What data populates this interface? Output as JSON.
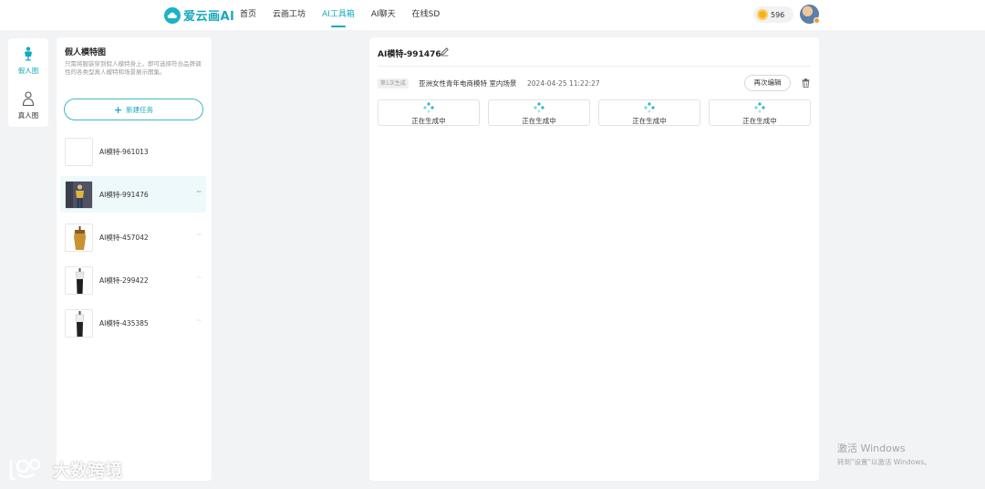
{
  "app": {
    "logo_text": "爱云画AI",
    "brand_color": "#17a9bf"
  },
  "nav": {
    "items": [
      {
        "label": "首页",
        "active": false
      },
      {
        "label": "云画工坊",
        "active": false
      },
      {
        "label": "AI工具箱",
        "active": true
      },
      {
        "label": "AI聊天",
        "active": false
      },
      {
        "label": "在线SD",
        "active": false
      }
    ]
  },
  "user": {
    "coins": "596"
  },
  "rail": {
    "items": [
      {
        "label": "假人图",
        "icon": "mannequin-icon",
        "active": true
      },
      {
        "label": "真人图",
        "icon": "person-icon",
        "active": false
      }
    ]
  },
  "panel": {
    "title": "假人模特图",
    "description": "只需将服装穿到假人模特身上，即可选择符合品牌调性的各类型真人模特和场景展示图集。",
    "new_task_label": "新建任务",
    "tasks": [
      {
        "name": "AI模特-961013",
        "thumb": "empty",
        "selected": false
      },
      {
        "name": "AI模特-991476",
        "thumb": "photo-dark",
        "selected": true
      },
      {
        "name": "AI模特-457042",
        "thumb": "mannequin-gold",
        "selected": false
      },
      {
        "name": "AI模特-299422",
        "thumb": "mannequin-black",
        "selected": false
      },
      {
        "name": "AI模特-435385",
        "thumb": "mannequin-black",
        "selected": false
      }
    ],
    "more_label": "···"
  },
  "main": {
    "title": "AI模特-991476",
    "generation": {
      "tag": "第1次生成",
      "description": "亚洲女性青年电商模特 室内场景",
      "time": "2024-04-25 11:22:27",
      "reedit_label": "再次编辑",
      "cards": [
        {
          "status": "正在生成中"
        },
        {
          "status": "正在生成中"
        },
        {
          "status": "正在生成中"
        },
        {
          "status": "正在生成中"
        }
      ]
    }
  },
  "watermark": {
    "text": "大数跨境"
  },
  "activation": {
    "line1": "激活 Windows",
    "line2": "转到\"设置\"以激活 Windows。"
  }
}
